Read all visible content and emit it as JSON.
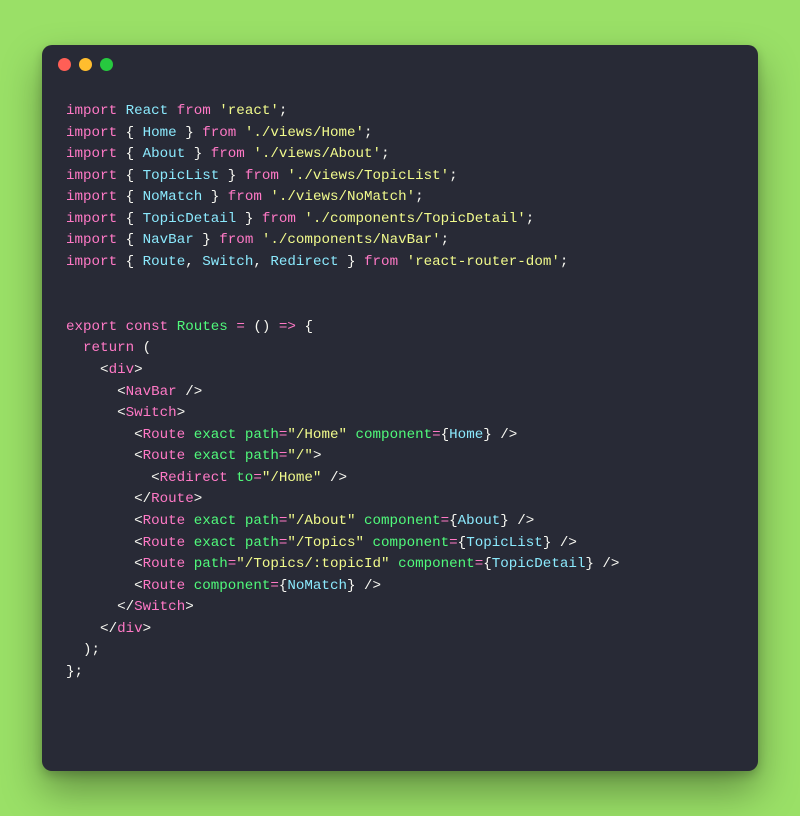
{
  "code": {
    "tokens": [
      [
        [
          "import ",
          "keyword"
        ],
        [
          "React ",
          "ident"
        ],
        [
          "from ",
          "keyword"
        ],
        [
          "'react'",
          "string"
        ],
        [
          ";",
          "punct"
        ]
      ],
      [
        [
          "import ",
          "keyword"
        ],
        [
          "{ ",
          "punct"
        ],
        [
          "Home ",
          "ident"
        ],
        [
          "} ",
          "punct"
        ],
        [
          "from ",
          "keyword"
        ],
        [
          "'./views/Home'",
          "string"
        ],
        [
          ";",
          "punct"
        ]
      ],
      [
        [
          "import ",
          "keyword"
        ],
        [
          "{ ",
          "punct"
        ],
        [
          "About ",
          "ident"
        ],
        [
          "} ",
          "punct"
        ],
        [
          "from ",
          "keyword"
        ],
        [
          "'./views/About'",
          "string"
        ],
        [
          ";",
          "punct"
        ]
      ],
      [
        [
          "import ",
          "keyword"
        ],
        [
          "{ ",
          "punct"
        ],
        [
          "TopicList ",
          "ident"
        ],
        [
          "} ",
          "punct"
        ],
        [
          "from ",
          "keyword"
        ],
        [
          "'./views/TopicList'",
          "string"
        ],
        [
          ";",
          "punct"
        ]
      ],
      [
        [
          "import ",
          "keyword"
        ],
        [
          "{ ",
          "punct"
        ],
        [
          "NoMatch ",
          "ident"
        ],
        [
          "} ",
          "punct"
        ],
        [
          "from ",
          "keyword"
        ],
        [
          "'./views/NoMatch'",
          "string"
        ],
        [
          ";",
          "punct"
        ]
      ],
      [
        [
          "import ",
          "keyword"
        ],
        [
          "{ ",
          "punct"
        ],
        [
          "TopicDetail ",
          "ident"
        ],
        [
          "} ",
          "punct"
        ],
        [
          "from ",
          "keyword"
        ],
        [
          "'./components/TopicDetail'",
          "string"
        ],
        [
          ";",
          "punct"
        ]
      ],
      [
        [
          "import ",
          "keyword"
        ],
        [
          "{ ",
          "punct"
        ],
        [
          "NavBar ",
          "ident"
        ],
        [
          "} ",
          "punct"
        ],
        [
          "from ",
          "keyword"
        ],
        [
          "'./components/NavBar'",
          "string"
        ],
        [
          ";",
          "punct"
        ]
      ],
      [
        [
          "import ",
          "keyword"
        ],
        [
          "{ ",
          "punct"
        ],
        [
          "Route",
          "ident"
        ],
        [
          ", ",
          "punct"
        ],
        [
          "Switch",
          "ident"
        ],
        [
          ", ",
          "punct"
        ],
        [
          "Redirect ",
          "ident"
        ],
        [
          "} ",
          "punct"
        ],
        [
          "from ",
          "keyword"
        ],
        [
          "'react-router-dom'",
          "string"
        ],
        [
          ";",
          "punct"
        ]
      ],
      [],
      [],
      [
        [
          "export ",
          "keyword"
        ],
        [
          "const ",
          "keyword"
        ],
        [
          "Routes ",
          "decl"
        ],
        [
          "= ",
          "keyword"
        ],
        [
          "() ",
          "paren"
        ],
        [
          "=> ",
          "keyword"
        ],
        [
          "{",
          "punct"
        ]
      ],
      [
        [
          "  ",
          "punct"
        ],
        [
          "return ",
          "keyword"
        ],
        [
          "(",
          "punct"
        ]
      ],
      [
        [
          "    <",
          "delim"
        ],
        [
          "div",
          "tag"
        ],
        [
          ">",
          "delim"
        ]
      ],
      [
        [
          "      <",
          "delim"
        ],
        [
          "NavBar ",
          "tag"
        ],
        [
          "/>",
          "delim"
        ]
      ],
      [
        [
          "      <",
          "delim"
        ],
        [
          "Switch",
          "tag"
        ],
        [
          ">",
          "delim"
        ]
      ],
      [
        [
          "        <",
          "delim"
        ],
        [
          "Route ",
          "tag"
        ],
        [
          "exact ",
          "attr"
        ],
        [
          "path",
          "attr"
        ],
        [
          "=",
          "keyword"
        ],
        [
          "\"/Home\" ",
          "string"
        ],
        [
          "component",
          "attr"
        ],
        [
          "=",
          "keyword"
        ],
        [
          "{",
          "punct"
        ],
        [
          "Home",
          "ident"
        ],
        [
          "} ",
          "punct"
        ],
        [
          "/>",
          "delim"
        ]
      ],
      [
        [
          "        <",
          "delim"
        ],
        [
          "Route ",
          "tag"
        ],
        [
          "exact ",
          "attr"
        ],
        [
          "path",
          "attr"
        ],
        [
          "=",
          "keyword"
        ],
        [
          "\"/\"",
          "string"
        ],
        [
          ">",
          "delim"
        ]
      ],
      [
        [
          "          <",
          "delim"
        ],
        [
          "Redirect ",
          "tag"
        ],
        [
          "to",
          "attr"
        ],
        [
          "=",
          "keyword"
        ],
        [
          "\"/Home\" ",
          "string"
        ],
        [
          "/>",
          "delim"
        ]
      ],
      [
        [
          "        </",
          "delim"
        ],
        [
          "Route",
          "tag"
        ],
        [
          ">",
          "delim"
        ]
      ],
      [
        [
          "        <",
          "delim"
        ],
        [
          "Route ",
          "tag"
        ],
        [
          "exact ",
          "attr"
        ],
        [
          "path",
          "attr"
        ],
        [
          "=",
          "keyword"
        ],
        [
          "\"/About\" ",
          "string"
        ],
        [
          "component",
          "attr"
        ],
        [
          "=",
          "keyword"
        ],
        [
          "{",
          "punct"
        ],
        [
          "About",
          "ident"
        ],
        [
          "} ",
          "punct"
        ],
        [
          "/>",
          "delim"
        ]
      ],
      [
        [
          "        <",
          "delim"
        ],
        [
          "Route ",
          "tag"
        ],
        [
          "exact ",
          "attr"
        ],
        [
          "path",
          "attr"
        ],
        [
          "=",
          "keyword"
        ],
        [
          "\"/Topics\" ",
          "string"
        ],
        [
          "component",
          "attr"
        ],
        [
          "=",
          "keyword"
        ],
        [
          "{",
          "punct"
        ],
        [
          "TopicList",
          "ident"
        ],
        [
          "} ",
          "punct"
        ],
        [
          "/>",
          "delim"
        ]
      ],
      [
        [
          "        <",
          "delim"
        ],
        [
          "Route ",
          "tag"
        ],
        [
          "path",
          "attr"
        ],
        [
          "=",
          "keyword"
        ],
        [
          "\"/Topics/:topicId\" ",
          "string"
        ],
        [
          "component",
          "attr"
        ],
        [
          "=",
          "keyword"
        ],
        [
          "{",
          "punct"
        ],
        [
          "TopicDetail",
          "ident"
        ],
        [
          "} ",
          "punct"
        ],
        [
          "/>",
          "delim"
        ]
      ],
      [
        [
          "        <",
          "delim"
        ],
        [
          "Route ",
          "tag"
        ],
        [
          "component",
          "attr"
        ],
        [
          "=",
          "keyword"
        ],
        [
          "{",
          "punct"
        ],
        [
          "NoMatch",
          "ident"
        ],
        [
          "} ",
          "punct"
        ],
        [
          "/>",
          "delim"
        ]
      ],
      [
        [
          "      </",
          "delim"
        ],
        [
          "Switch",
          "tag"
        ],
        [
          ">",
          "delim"
        ]
      ],
      [
        [
          "    </",
          "delim"
        ],
        [
          "div",
          "tag"
        ],
        [
          ">",
          "delim"
        ]
      ],
      [
        [
          "  );",
          "punct"
        ]
      ],
      [
        [
          "};",
          "punct"
        ]
      ]
    ]
  }
}
